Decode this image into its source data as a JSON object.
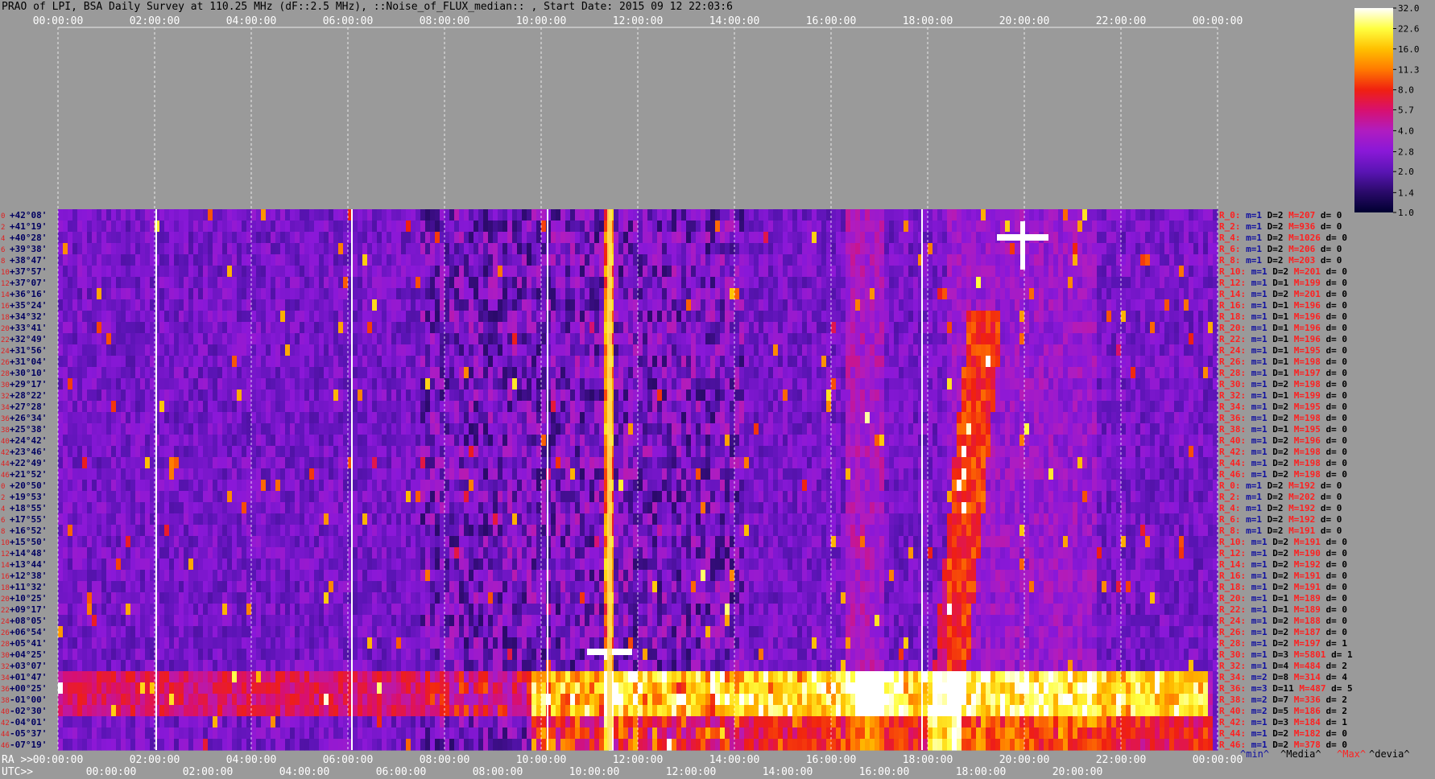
{
  "title": "PRAO of LPI, BSA Daily Survey at 110.25 MHz (dF::2.5 MHz), ::Noise_of_FLUX_median:: , Start Date: 2015 09 12 22:03:6",
  "chart_data": {
    "type": "heatmap",
    "title": "PRAO of LPI, BSA Daily Survey at 110.25 MHz (dF::2.5 MHz), ::Noise_of_FLUX_median:: , Start Date: 2015 09 12 22:03:6",
    "x_top_ticks": [
      "00:00:00",
      "02:00:00",
      "04:00:00",
      "06:00:00",
      "08:00:00",
      "10:00:00",
      "12:00:00",
      "14:00:00",
      "16:00:00",
      "18:00:00",
      "20:00:00",
      "22:00:00",
      "00:00:00"
    ],
    "x_bottom_ra_label": "RA >>",
    "x_bottom_ra_ticks": [
      "00:00:00",
      "02:00:00",
      "04:00:00",
      "06:00:00",
      "08:00:00",
      "10:00:00",
      "12:00:00",
      "14:00:00",
      "16:00:00",
      "18:00:00",
      "20:00:00",
      "22:00:00",
      "00:00:00"
    ],
    "x_bottom_utc_label": "UTC>>",
    "x_bottom_utc_ticks": [
      "00:00:00",
      "02:00:00",
      "04:00:00",
      "06:00:00",
      "08:00:00",
      "10:00:00",
      "12:00:00",
      "14:00:00",
      "16:00:00",
      "18:00:00",
      "20:00:00"
    ],
    "y_declination_labels": [
      "+42°08'",
      "+41°19'",
      "+40°28'",
      "+39°38'",
      "+38°47'",
      "+37°57'",
      "+37°07'",
      "+36°16'",
      "+35°24'",
      "+34°32'",
      "+33°41'",
      "+32°49'",
      "+31°56'",
      "+31°04'",
      "+30°10'",
      "+29°17'",
      "+28°22'",
      "+27°28'",
      "+26°34'",
      "+25°38'",
      "+24°42'",
      "+23°46'",
      "+22°49'",
      "+21°52'",
      "+20°50'",
      "+19°53'",
      "+18°55'",
      "+17°55'",
      "+16°52'",
      "+15°50'",
      "+14°48'",
      "+13°44'",
      "+12°38'",
      "+11°32'",
      "+10°25'",
      "+09°17'",
      "+08°05'",
      "+06°54'",
      "+05°41'",
      "+04°25'",
      "+03°07'",
      "+01°47'",
      "+00°25'",
      "-01°00'",
      "-02°30'",
      "-04°01'",
      "-05°37'",
      "-07°19'"
    ],
    "y_index_labels": [
      "0",
      "2",
      "4",
      "6",
      "8",
      "10",
      "12",
      "14",
      "16",
      "18",
      "20",
      "22",
      "24",
      "26",
      "28",
      "30",
      "32",
      "34",
      "36",
      "38",
      "40",
      "42",
      "44",
      "46",
      "0",
      "2",
      "4",
      "6",
      "8",
      "10",
      "12",
      "14",
      "16",
      "18",
      "20",
      "22",
      "24",
      "26",
      "28",
      "30",
      "32",
      "34",
      "36",
      "38",
      "40",
      "42",
      "44",
      "46"
    ],
    "row_stats": [
      {
        "r": "R_0:",
        "m": "m=1",
        "d": "D=2",
        "M": "M=207",
        "dv": "d= 0"
      },
      {
        "r": "R_2:",
        "m": "m=1",
        "d": "D=2",
        "M": "M=936",
        "dv": "d= 0"
      },
      {
        "r": "R_4:",
        "m": "m=1",
        "d": "D=2",
        "M": "M=1026",
        "dv": "d= 0"
      },
      {
        "r": "R_6:",
        "m": "m=1",
        "d": "D=2",
        "M": "M=206",
        "dv": "d= 0"
      },
      {
        "r": "R_8:",
        "m": "m=1",
        "d": "D=2",
        "M": "M=203",
        "dv": "d= 0"
      },
      {
        "r": "R_10:",
        "m": "m=1",
        "d": "D=2",
        "M": "M=201",
        "dv": "d= 0"
      },
      {
        "r": "R_12:",
        "m": "m=1",
        "d": "D=1",
        "M": "M=199",
        "dv": "d= 0"
      },
      {
        "r": "R_14:",
        "m": "m=1",
        "d": "D=2",
        "M": "M=201",
        "dv": "d= 0"
      },
      {
        "r": "R_16:",
        "m": "m=1",
        "d": "D=1",
        "M": "M=196",
        "dv": "d= 0"
      },
      {
        "r": "R_18:",
        "m": "m=1",
        "d": "D=1",
        "M": "M=196",
        "dv": "d= 0"
      },
      {
        "r": "R_20:",
        "m": "m=1",
        "d": "D=1",
        "M": "M=196",
        "dv": "d= 0"
      },
      {
        "r": "R_22:",
        "m": "m=1",
        "d": "D=1",
        "M": "M=196",
        "dv": "d= 0"
      },
      {
        "r": "R_24:",
        "m": "m=1",
        "d": "D=1",
        "M": "M=195",
        "dv": "d= 0"
      },
      {
        "r": "R_26:",
        "m": "m=1",
        "d": "D=1",
        "M": "M=198",
        "dv": "d= 0"
      },
      {
        "r": "R_28:",
        "m": "m=1",
        "d": "D=1",
        "M": "M=197",
        "dv": "d= 0"
      },
      {
        "r": "R_30:",
        "m": "m=1",
        "d": "D=2",
        "M": "M=198",
        "dv": "d= 0"
      },
      {
        "r": "R_32:",
        "m": "m=1",
        "d": "D=1",
        "M": "M=199",
        "dv": "d= 0"
      },
      {
        "r": "R_34:",
        "m": "m=1",
        "d": "D=2",
        "M": "M=195",
        "dv": "d= 0"
      },
      {
        "r": "R_36:",
        "m": "m=1",
        "d": "D=2",
        "M": "M=198",
        "dv": "d= 0"
      },
      {
        "r": "R_38:",
        "m": "m=1",
        "d": "D=1",
        "M": "M=195",
        "dv": "d= 0"
      },
      {
        "r": "R_40:",
        "m": "m=1",
        "d": "D=2",
        "M": "M=196",
        "dv": "d= 0"
      },
      {
        "r": "R_42:",
        "m": "m=1",
        "d": "D=2",
        "M": "M=198",
        "dv": "d= 0"
      },
      {
        "r": "R_44:",
        "m": "m=1",
        "d": "D=2",
        "M": "M=198",
        "dv": "d= 0"
      },
      {
        "r": "R_46:",
        "m": "m=1",
        "d": "D=2",
        "M": "M=198",
        "dv": "d= 0"
      },
      {
        "r": "R_0:",
        "m": "m=1",
        "d": "D=2",
        "M": "M=192",
        "dv": "d= 0"
      },
      {
        "r": "R_2:",
        "m": "m=1",
        "d": "D=2",
        "M": "M=202",
        "dv": "d= 0"
      },
      {
        "r": "R_4:",
        "m": "m=1",
        "d": "D=2",
        "M": "M=192",
        "dv": "d= 0"
      },
      {
        "r": "R_6:",
        "m": "m=1",
        "d": "D=2",
        "M": "M=192",
        "dv": "d= 0"
      },
      {
        "r": "R_8:",
        "m": "m=1",
        "d": "D=2",
        "M": "M=191",
        "dv": "d= 0"
      },
      {
        "r": "R_10:",
        "m": "m=1",
        "d": "D=2",
        "M": "M=191",
        "dv": "d= 0"
      },
      {
        "r": "R_12:",
        "m": "m=1",
        "d": "D=2",
        "M": "M=190",
        "dv": "d= 0"
      },
      {
        "r": "R_14:",
        "m": "m=1",
        "d": "D=2",
        "M": "M=192",
        "dv": "d= 0"
      },
      {
        "r": "R_16:",
        "m": "m=1",
        "d": "D=2",
        "M": "M=191",
        "dv": "d= 0"
      },
      {
        "r": "R_18:",
        "m": "m=1",
        "d": "D=2",
        "M": "M=191",
        "dv": "d= 0"
      },
      {
        "r": "R_20:",
        "m": "m=1",
        "d": "D=1",
        "M": "M=189",
        "dv": "d= 0"
      },
      {
        "r": "R_22:",
        "m": "m=1",
        "d": "D=1",
        "M": "M=189",
        "dv": "d= 0"
      },
      {
        "r": "R_24:",
        "m": "m=1",
        "d": "D=2",
        "M": "M=188",
        "dv": "d= 0"
      },
      {
        "r": "R_26:",
        "m": "m=1",
        "d": "D=2",
        "M": "M=187",
        "dv": "d= 0"
      },
      {
        "r": "R_28:",
        "m": "m=1",
        "d": "D=2",
        "M": "M=197",
        "dv": "d= 1"
      },
      {
        "r": "R_30:",
        "m": "m=1",
        "d": "D=3",
        "M": "M=5801",
        "dv": "d= 1"
      },
      {
        "r": "R_32:",
        "m": "m=1",
        "d": "D=4",
        "M": "M=484",
        "dv": "d= 2"
      },
      {
        "r": "R_34:",
        "m": "m=2",
        "d": "D=8",
        "M": "M=314",
        "dv": "d= 4"
      },
      {
        "r": "R_36:",
        "m": "m=3",
        "d": "D=11",
        "M": "M=487",
        "dv": "d= 5"
      },
      {
        "r": "R_38:",
        "m": "m=2",
        "d": "D=7",
        "M": "M=336",
        "dv": "d= 2"
      },
      {
        "r": "R_40:",
        "m": "m=2",
        "d": "D=5",
        "M": "M=186",
        "dv": "d= 2"
      },
      {
        "r": "R_42:",
        "m": "m=1",
        "d": "D=3",
        "M": "M=184",
        "dv": "d= 1"
      },
      {
        "r": "R_44:",
        "m": "m=1",
        "d": "D=2",
        "M": "M=182",
        "dv": "d= 0"
      },
      {
        "r": "R_46:",
        "m": "m=1",
        "d": "D=2",
        "M": "M=378",
        "dv": "d= 0"
      }
    ],
    "stats_legend": [
      "^min^",
      "^Media^",
      "^Max^",
      "^devia^"
    ],
    "colorbar": {
      "ticks": [
        "32.0",
        "22.6",
        "16.0",
        "11.3",
        "8.0",
        "5.7",
        "4.0",
        "2.8",
        "2.0",
        "1.4",
        "1.0"
      ],
      "tick_values": [
        32.0,
        22.6,
        16.0,
        11.3,
        8.0,
        5.7,
        4.0,
        2.8,
        2.0,
        1.4,
        1.0
      ],
      "colors": [
        "#000030",
        "#2a0a6a",
        "#5a14b4",
        "#8a18d8",
        "#b01cc0",
        "#d81070",
        "#f02010",
        "#ff7a00",
        "#ffc000",
        "#ffff40",
        "#ffffff"
      ]
    },
    "features": [
      {
        "name": "vertical bright source",
        "ra": "11:25",
        "intensity": 9
      },
      {
        "name": "bright horizontal band",
        "dec_from": "+01°47'",
        "dec_to": "-02°30'",
        "intensity": 7
      },
      {
        "name": "cross-shaped source",
        "ra": "19:58",
        "dec": "+41°19'",
        "intensity": 12
      },
      {
        "name": "diffuse emission ridge",
        "ra_from": "16:15",
        "ra_to": "17:05",
        "intensity": 3
      }
    ]
  },
  "colors": {
    "background": "#9a9a9a",
    "stat_red": "#ff2020",
    "stat_blue": "#1010a0",
    "index_red": "#e02020"
  }
}
